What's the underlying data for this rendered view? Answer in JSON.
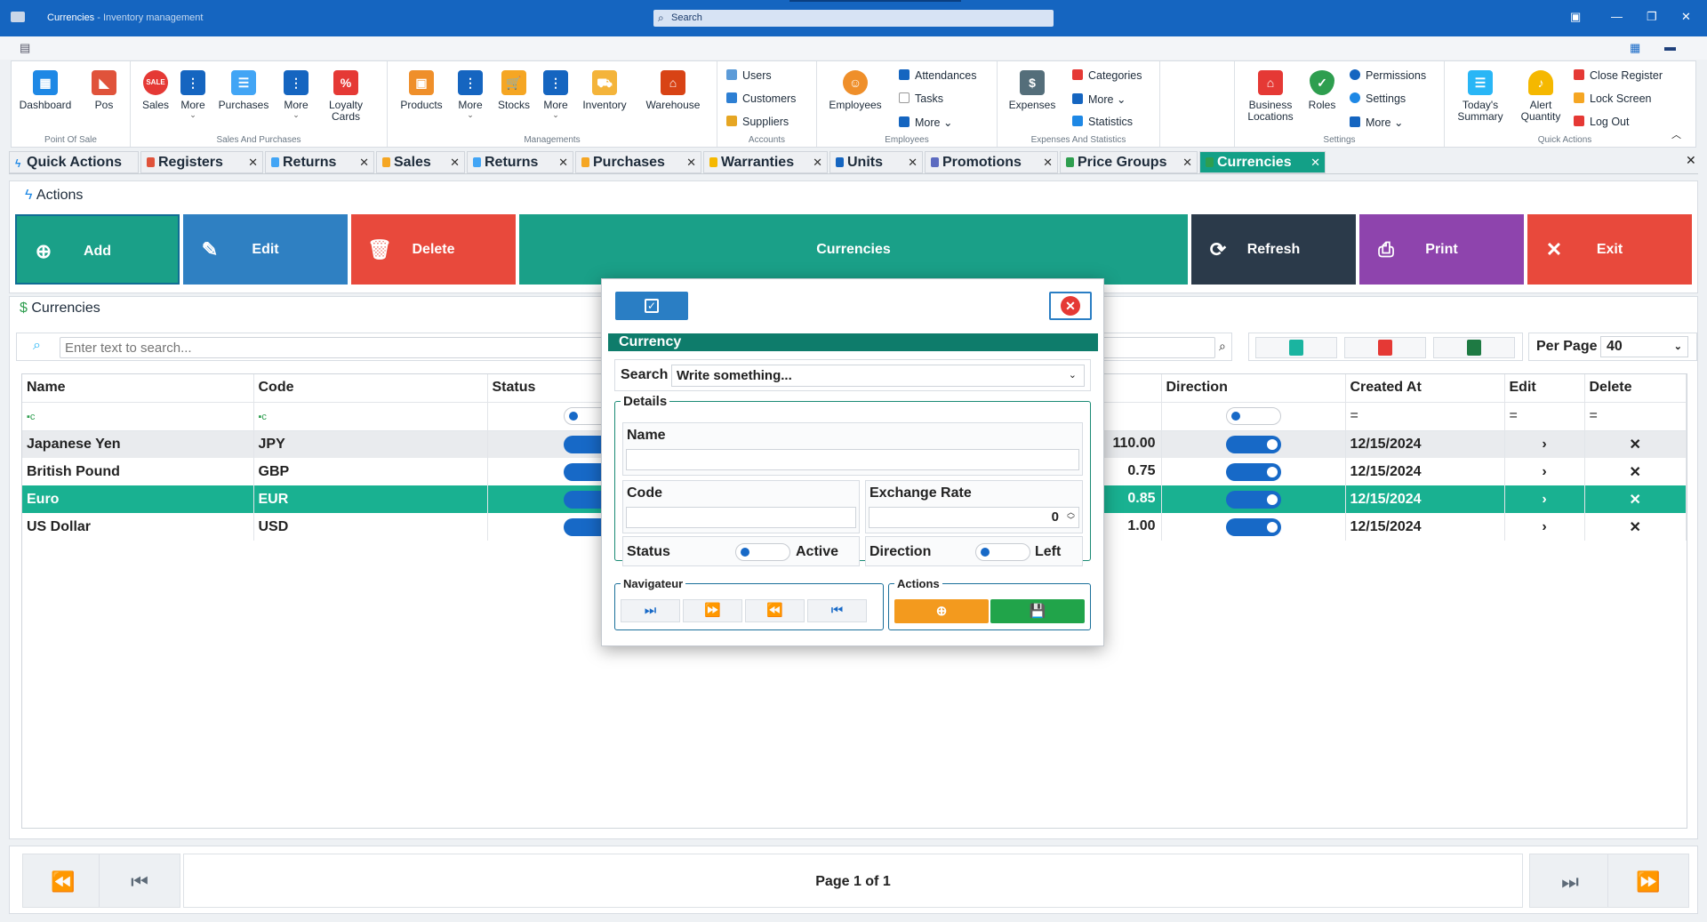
{
  "window": {
    "title": "Currencies",
    "subtitle": "- Inventory management",
    "search_placeholder": "Search"
  },
  "ribbon": {
    "groups": [
      "Point Of Sale",
      "Sales And Purchases",
      "Managements",
      "Accounts",
      "Employees",
      "Expenses And Statistics",
      "Settings",
      "Quick Actions"
    ],
    "buttons": {
      "dashboard": "Dashboard",
      "pos": "Pos",
      "sales": "Sales",
      "more1": "More",
      "purchases": "Purchases",
      "more2": "More",
      "loyalty": "Loyalty Cards",
      "products": "Products",
      "more3": "More",
      "stocks": "Stocks",
      "more4": "More",
      "inventory": "Inventory",
      "warehouse": "Warehouse",
      "users": "Users",
      "customers": "Customers",
      "suppliers": "Suppliers",
      "employees": "Employees",
      "attendances": "Attendances",
      "tasks": "Tasks",
      "more5": "More",
      "expenses": "Expenses",
      "categories": "Categories",
      "more6": "More",
      "statistics": "Statistics",
      "business": "Business Locations",
      "roles": "Roles",
      "permissions": "Permissions",
      "settings": "Settings",
      "more7": "More",
      "summary": "Today's Summary",
      "alert": "Alert Quantity",
      "close_register": "Close Register",
      "lock": "Lock Screen",
      "logout": "Log Out"
    }
  },
  "tabs": [
    "Quick Actions",
    "Registers",
    "Returns",
    "Sales",
    "Returns",
    "Purchases",
    "Warranties",
    "Units",
    "Promotions",
    "Price Groups",
    "Currencies"
  ],
  "actions": {
    "title": "Actions",
    "add": "Add",
    "edit": "Edit",
    "delete": "Delete",
    "center": "Currencies",
    "refresh": "Refresh",
    "print": "Print",
    "exit": "Exit"
  },
  "list": {
    "title": "Currencies",
    "search_placeholder": "Enter text to search...",
    "per_page_label": "Per Page",
    "per_page_value": "40"
  },
  "table": {
    "columns": [
      "Name",
      "Code",
      "Status",
      "Direction",
      "Created At",
      "Edit",
      "Delete"
    ],
    "rows": [
      {
        "name": "Japanese Yen",
        "code": "JPY",
        "rate": "110.00",
        "created": "12/15/2024"
      },
      {
        "name": "British Pound",
        "code": "GBP",
        "rate": "0.75",
        "created": "12/15/2024"
      },
      {
        "name": "Euro",
        "code": "EUR",
        "rate": "0.85",
        "created": "12/15/2024"
      },
      {
        "name": "US Dollar",
        "code": "USD",
        "rate": "1.00",
        "created": "12/15/2024"
      }
    ]
  },
  "pager": {
    "label": "Page 1 of 1"
  },
  "dialog": {
    "header": "Currency",
    "search_label": "Search",
    "search_value": "Write something...",
    "details_legend": "Details",
    "name_label": "Name",
    "code_label": "Code",
    "rate_label": "Exchange Rate",
    "rate_value": "0",
    "status_label": "Status",
    "status_value": "Active",
    "direction_label": "Direction",
    "direction_value": "Left",
    "nav_legend": "Navigateur",
    "actions_legend": "Actions"
  }
}
